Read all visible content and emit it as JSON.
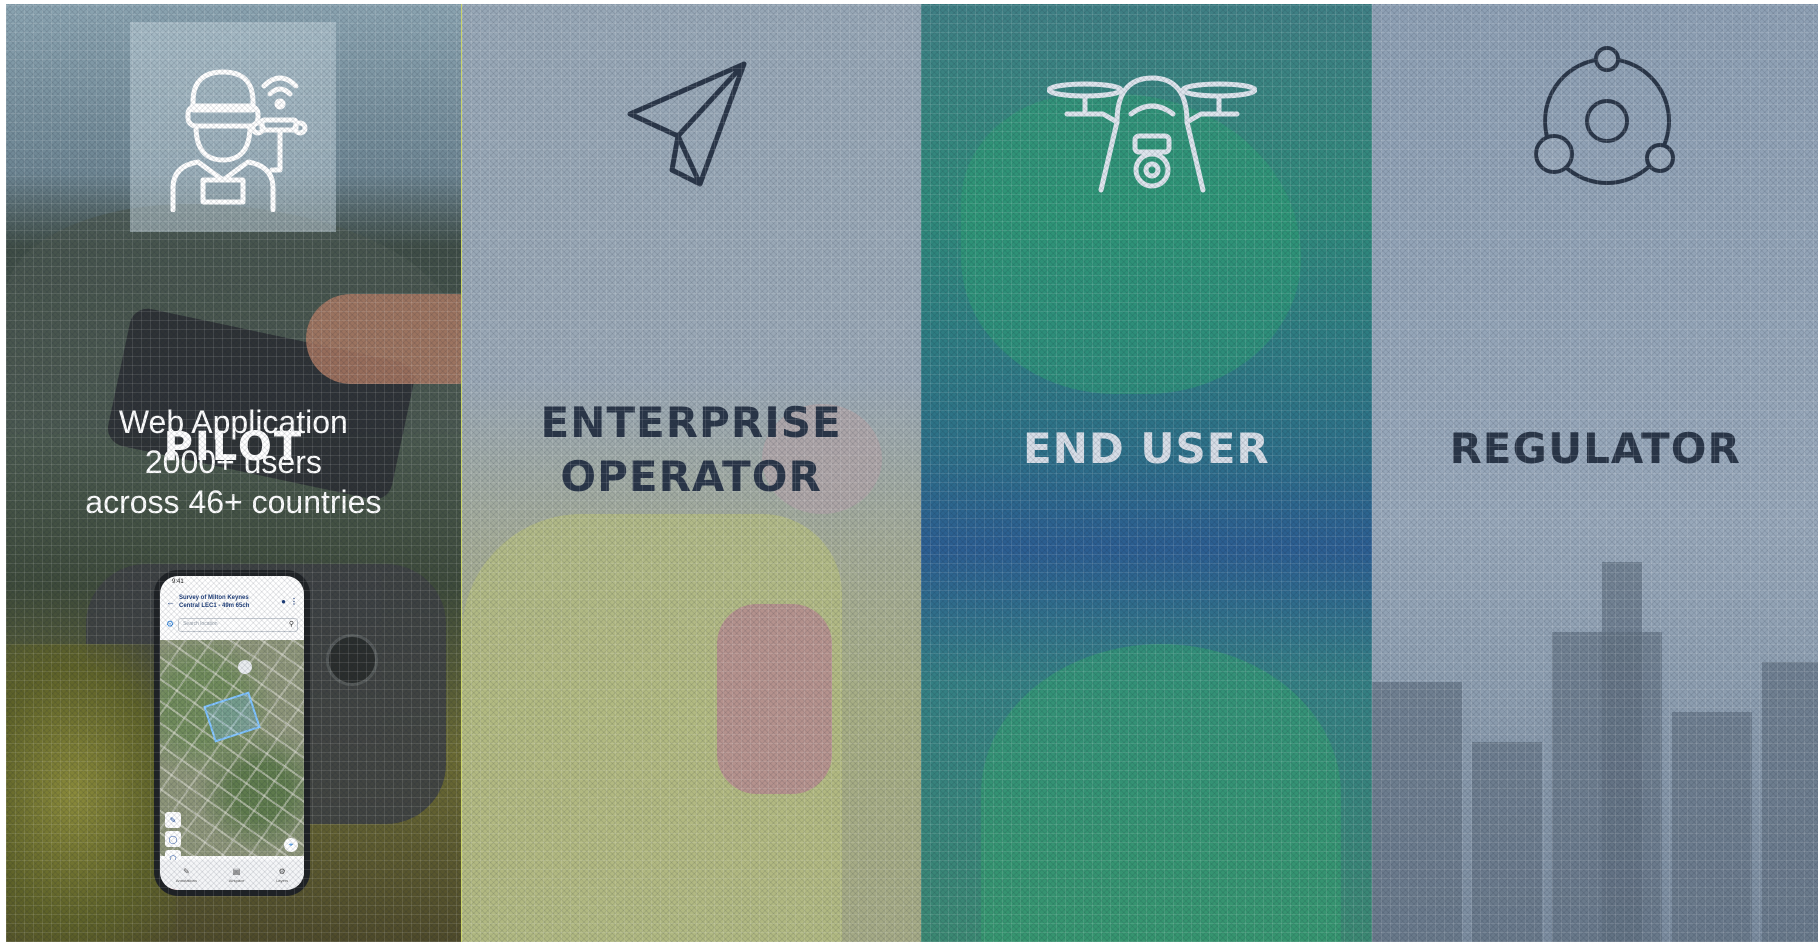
{
  "panels": [
    {
      "id": "pilot",
      "title": "PILOT",
      "overlay_lines": [
        "Web Application",
        "2000+ users",
        "across 46+ countries"
      ],
      "icon": "pilot-with-drone-icon"
    },
    {
      "id": "enterprise-operator",
      "title_lines": [
        "ENTERPRISE",
        "OPERATOR"
      ],
      "icon": "paper-plane-icon"
    },
    {
      "id": "end-user",
      "title": "END USER",
      "icon": "drone-icon"
    },
    {
      "id": "regulator",
      "title": "REGULATOR",
      "icon": "orbit-network-icon"
    }
  ],
  "phone": {
    "status_time": "9:41",
    "header_line1": "Survey of Milton Keynes",
    "header_line2": "Central LEC1 - 49m 65ch",
    "search_placeholder": "Search location",
    "tabs": [
      "Annotations",
      "Airspace",
      "Layers"
    ]
  },
  "colors": {
    "title_dark": "#2a3648",
    "title_light": "#d6dde6",
    "end_user_bg": "#2d6f88"
  }
}
